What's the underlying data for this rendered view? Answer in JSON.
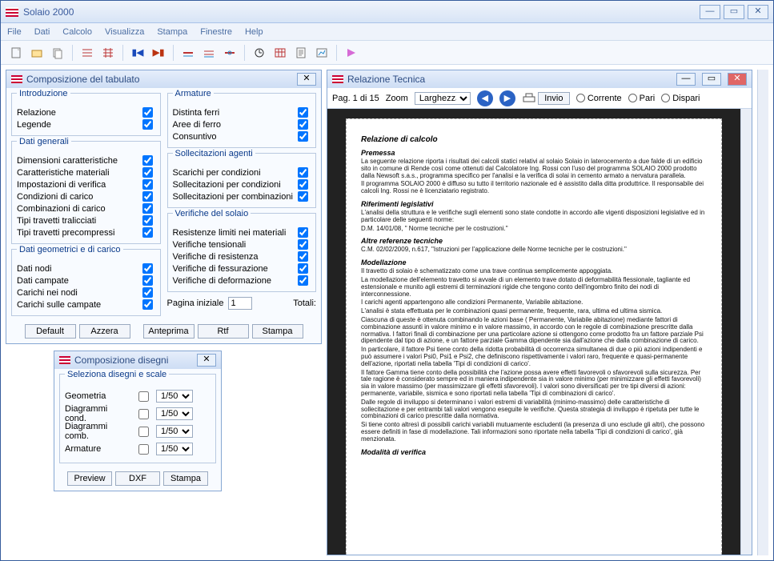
{
  "app": {
    "title": "Solaio 2000"
  },
  "menu": [
    "File",
    "Dati",
    "Calcolo",
    "Visualizza",
    "Stampa",
    "Finestre",
    "Help"
  ],
  "tabulato": {
    "title": "Composizione del tabulato",
    "g1": {
      "label": "Introduzione",
      "items": [
        "Relazione",
        "Legende"
      ]
    },
    "g2": {
      "label": "Dati generali",
      "items": [
        "Dimensioni caratteristiche",
        "Caratteristiche materiali",
        "Impostazioni di verifica",
        "Condizioni di carico",
        "Combinazioni di carico",
        "Tipi travetti tralicciati",
        "Tipi travetti precompressi"
      ]
    },
    "g3": {
      "label": "Dati geometrici e di carico",
      "items": [
        "Dati nodi",
        "Dati campate",
        "Carichi nei nodi",
        "Carichi sulle campate"
      ]
    },
    "g4": {
      "label": "Armature",
      "items": [
        "Distinta ferri",
        "Aree di ferro",
        "Consuntivo"
      ]
    },
    "g5": {
      "label": "Sollecitazioni agenti",
      "items": [
        "Scarichi per condizioni",
        "Sollecitazioni per condizioni",
        "Sollecitazioni per combinazioni"
      ]
    },
    "g6": {
      "label": "Verifiche del solaio",
      "items": [
        "Resistenze limiti nei materiali",
        "Verifiche tensionali",
        "Verifiche di resistenza",
        "Verifiche di fessurazione",
        "Verifiche di deformazione"
      ]
    },
    "pag_label": "Pagina iniziale",
    "pag_value": "1",
    "totali_label": "Totali:",
    "buttons": [
      "Default",
      "Azzera",
      "Anteprima",
      "Rtf",
      "Stampa"
    ]
  },
  "disegni": {
    "title": "Composizione disegni",
    "group": "Seleziona disegni e scale",
    "rows": [
      {
        "label": "Geometria",
        "scale": "1/50"
      },
      {
        "label": "Diagrammi cond.",
        "scale": "1/50"
      },
      {
        "label": "Diagrammi comb.",
        "scale": "1/50"
      },
      {
        "label": "Armature",
        "scale": "1/50"
      }
    ],
    "buttons": [
      "Preview",
      "DXF",
      "Stampa"
    ]
  },
  "relazione": {
    "title": "Relazione Tecnica",
    "pag": "Pag. 1 di 15",
    "zoom_label": "Zoom",
    "zoom_value": "Larghezza",
    "invio": "Invio",
    "radios": [
      "Corrente",
      "Pari",
      "Dispari"
    ]
  },
  "doc": {
    "h1": "Relazione di calcolo",
    "s1t": "Premessa",
    "s1a": "La seguente relazione riporta i risultati dei calcoli statici relativi al solaio Solaio in laterocemento a due falde di un edificio sito in comune di Rende così come ottenuti dal Calcolatore Ing. Rossi con l'uso del programma SOLAIO 2000 prodotto dalla Newsoft s.a.s., programma specifico per l'analisi e la verifica di solai in cemento armato a nervatura parallela.",
    "s1b": "Il programma SOLAIO 2000 è diffuso su tutto il territorio nazionale ed è assistito dalla ditta produttrice. Il responsabile dei calcoli Ing. Rossi ne è licenziatario registrato.",
    "s2t": "Riferimenti legislativi",
    "s2a": "L'analisi della struttura e le verifiche sugli elementi sono state condotte in accordo alle vigenti disposizioni legislative ed in particolare delle seguenti norme:",
    "s2b": "D.M. 14/01/08, \" Norme tecniche per le costruzioni.\"",
    "s3t": "Altre referenze tecniche",
    "s3a": "C.M. 02/02/2009, n.617, \"Istruzioni per l'applicazione delle Norme tecniche per le costruzioni.\"",
    "s4t": "Modellazione",
    "s4a": "Il travetto di solaio è schematizzato come una trave continua semplicemente appoggiata.",
    "s4b": "La modellazione dell'elemento travetto si avvale di un elemento trave dotato di deformabilità flessionale, tagliante ed estensionale e munito agli estremi di terminazioni rigide che tengono conto dell'ingombro finito dei nodi di interconnessione.",
    "s4c": "I carichi agenti appartengono alle condizioni Permanente, Variabile abitazione.",
    "s4d": "L'analisi è stata effettuata per le combinazioni quasi permanente, frequente, rara, ultima ed ultima sismica.",
    "s4e": "Ciascuna di queste è ottenuta combinando le azioni base ( Permanente, Variabile abitazione) mediante fattori di combinazione assunti in valore minimo e in valore massimo, in accordo con le regole di combinazione prescritte dalla normativa. I fattori finali di combinazione per una particolare azione si ottengono come prodotto fra un fattore parziale Psi dipendente dal tipo di azione, e un fattore parziale Gamma dipendente sia dall'azione che dalla combinazione di carico.",
    "s4f": "In particolare, il fattore Psi tiene conto della ridotta probabilità di occorrenza simultanea di due o più azioni indipendenti e può assumere i valori Psi0, Psi1 e Psi2, che definiscono rispettivamente i valori raro, frequente e quasi-permanente dell'azione, riportati nella tabella 'Tipi di condizioni di carico'.",
    "s4g": "Il fattore Gamma tiene conto della possibilità che l'azione possa avere effetti favorevoli o sfavorevoli sulla sicurezza. Per tale ragione è considerato sempre ed in maniera indipendente sia in valore minimo (per minimizzare gli effetti favorevoli) sia in valore massimo (per massimizzare gli effetti sfavorevoli). I valori sono diversificati per tre tipi diversi di azioni: permanente, variabile, sismica e sono riportati nella tabella 'Tipi di combinazioni di carico'.",
    "s4h": "Dalle regole di inviluppo si determinano i valori estremi di variabilità (minimo-massimo) delle caratteristiche di sollecitazione e per entrambi tali valori vengono eseguite le verifiche. Questa strategia di inviluppo è ripetuta per tutte le combinazioni di carico prescritte dalla normativa.",
    "s4i": "Si tiene conto altresì di possibili carichi variabili mutuamente escludenti (la presenza di uno esclude gli altri), che possono essere definiti in fase di modellazione. Tali informazioni sono riportate nella tabella 'Tipi di condizioni di carico', già menzionata.",
    "s5t": "Modalità di verifica"
  }
}
